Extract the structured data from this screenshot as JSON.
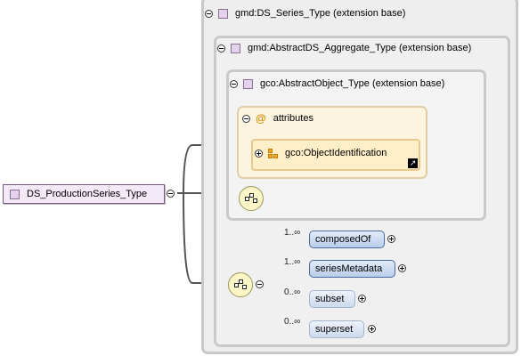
{
  "root": {
    "label": "DS_ProductionSeries_Type"
  },
  "extension_levels": [
    {
      "label": "gmd:DS_Series_Type (extension base)"
    },
    {
      "label": "gmd:AbstractDS_Aggregate_Type (extension base)"
    },
    {
      "label": "gco:AbstractObject_Type (extension base)"
    }
  ],
  "attributes": {
    "label": "attributes",
    "at_symbol": "@",
    "items": [
      {
        "label": "gco:ObjectIdentification"
      }
    ]
  },
  "elements": [
    {
      "label": "composedOf",
      "cardinality": "1..∞",
      "optional": false
    },
    {
      "label": "seriesMetadata",
      "cardinality": "1..∞",
      "optional": false
    },
    {
      "label": "subset",
      "cardinality": "0..∞",
      "optional": true
    },
    {
      "label": "superset",
      "cardinality": "0..∞",
      "optional": true
    }
  ],
  "icons": {
    "collapse": "minus-circle-icon",
    "expand": "plus-circle-icon",
    "type": "complex-type-icon",
    "sequence": "sequence-compositor-icon",
    "reference": "reference-arrow-icon"
  },
  "colors": {
    "extension_border": "#c9c9c9",
    "attributes_bg": "#fdf4df",
    "element_fill": "#b9cdea",
    "type_icon": "#e4d2ec"
  }
}
